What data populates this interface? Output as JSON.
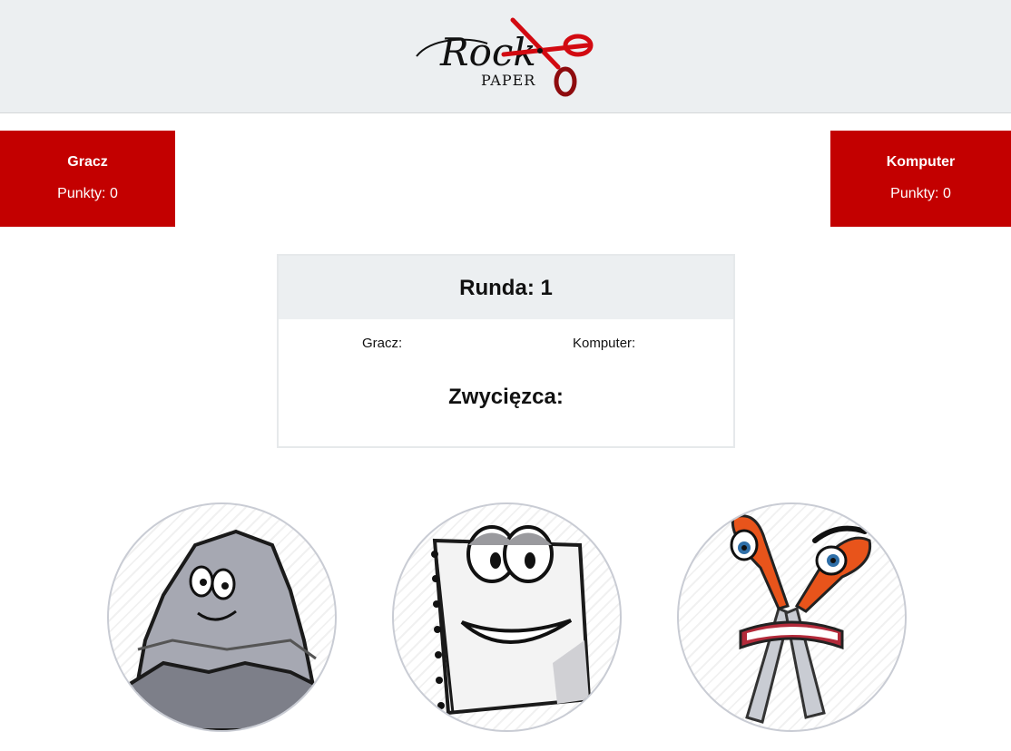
{
  "header": {
    "logo": {
      "word_rock": "Rock",
      "word_paper": "PAPER",
      "icon": "scissors-icon",
      "accent": "#d20a11"
    }
  },
  "scoreboard": {
    "player": {
      "name": "Gracz",
      "score_text": "Punkty: 0"
    },
    "computer": {
      "name": "Komputer",
      "score_text": "Punkty: 0"
    },
    "color": "#c30000"
  },
  "round": {
    "title": "Runda: 1",
    "player_pick_label": "Gracz:",
    "computer_pick_label": "Komputer:",
    "winner_label": "Zwycięzca:"
  },
  "choices": [
    {
      "id": "rock",
      "icon": "rock-character-icon"
    },
    {
      "id": "paper",
      "icon": "paper-character-icon"
    },
    {
      "id": "scissors",
      "icon": "scissors-character-icon"
    }
  ]
}
